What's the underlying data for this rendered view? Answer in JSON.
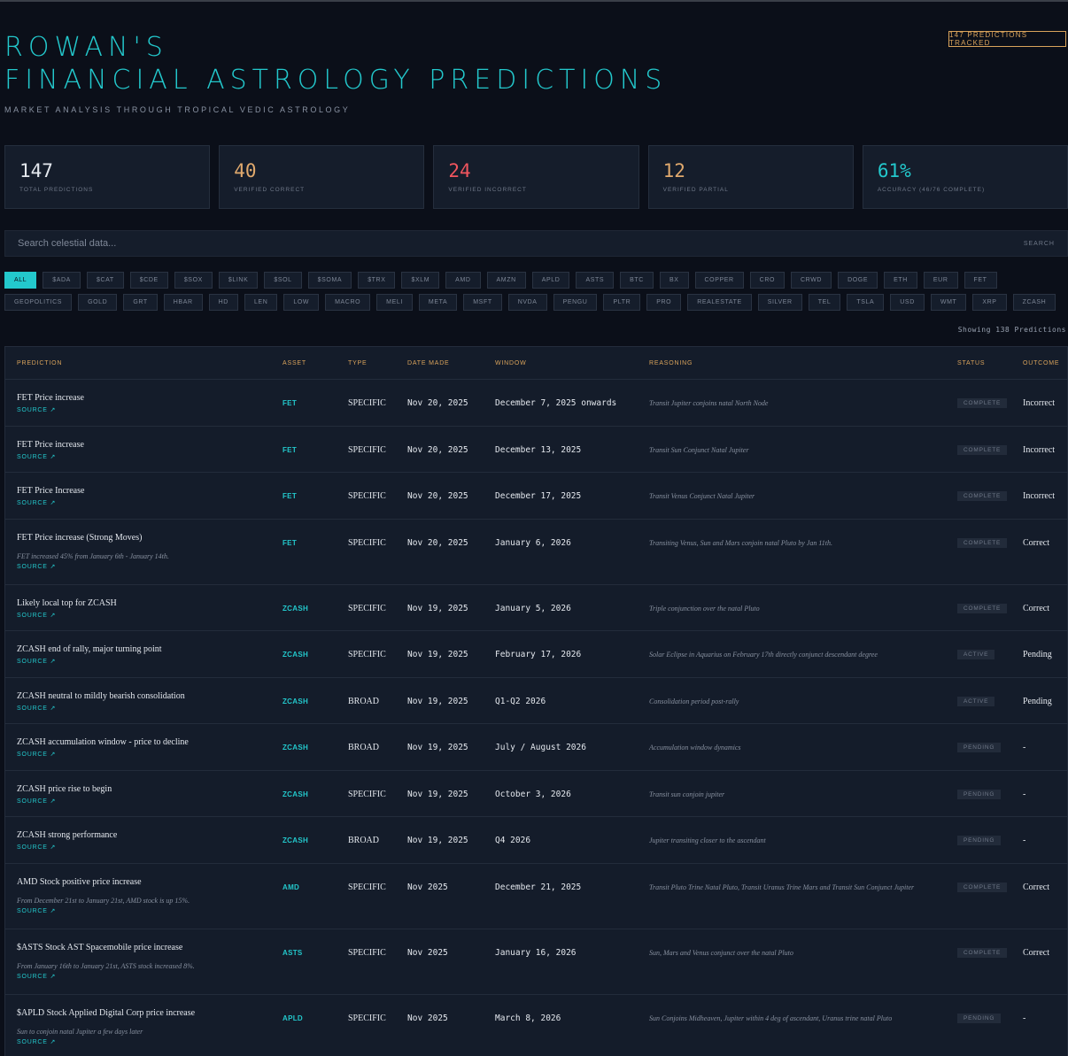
{
  "header": {
    "title_line1": "ROWAN'S",
    "title_line2": "FINANCIAL ASTROLOGY PREDICTIONS",
    "subtitle": "MARKET ANALYSIS THROUGH TROPICAL VEDIC ASTROLOGY",
    "tracked_badge": "147 PREDICTIONS TRACKED"
  },
  "stats": [
    {
      "value": "147",
      "label": "TOTAL PREDICTIONS",
      "color": "#e4e8ee"
    },
    {
      "value": "40",
      "label": "VERIFIED CORRECT",
      "color": "#e0a96d"
    },
    {
      "value": "24",
      "label": "VERIFIED INCORRECT",
      "color": "#f0555e"
    },
    {
      "value": "12",
      "label": "VERIFIED PARTIAL",
      "color": "#e0a96d"
    },
    {
      "value": "61%",
      "label": "ACCURACY (46/76 COMPLETE)",
      "color": "#23c8cc"
    }
  ],
  "search": {
    "placeholder": "Search celestial data...",
    "button": "SEARCH"
  },
  "filters": {
    "active": "ALL",
    "items": [
      "ALL",
      "$ADA",
      "$CAT",
      "$CDE",
      "$SOX",
      "$LINK",
      "$SOL",
      "$SOMA",
      "$TRX",
      "$XLM",
      "AMD",
      "AMZN",
      "APLD",
      "ASTS",
      "BTC",
      "BX",
      "COPPER",
      "CRO",
      "CRWD",
      "DOGE",
      "ETH",
      "EUR",
      "FET",
      "GEOPOLITICS",
      "GOLD",
      "GRT",
      "HBAR",
      "HD",
      "LEN",
      "LOW",
      "MACRO",
      "MELI",
      "META",
      "MSFT",
      "NVDA",
      "PENGU",
      "PLTR",
      "PRO",
      "REALESTATE",
      "SILVER",
      "TEL",
      "TSLA",
      "USD",
      "WMT",
      "XRP",
      "ZCASH"
    ]
  },
  "showing": "Showing 138 Predictions",
  "table": {
    "headers": {
      "prediction": "PREDICTION",
      "asset": "ASSET",
      "type": "TYPE",
      "date_made": "DATE MADE",
      "window": "WINDOW",
      "reasoning": "REASONING",
      "status": "STATUS",
      "outcome": "OUTCOME"
    },
    "source_label": "SOURCE ↗",
    "rows": [
      {
        "prediction": "FET Price increase",
        "note": "",
        "asset": "FET",
        "type": "SPECIFIC",
        "date": "Nov 20, 2025",
        "window": "December 7, 2025 onwards",
        "reasoning": "Transit Jupiter conjoins natal North Node",
        "status": "COMPLETE",
        "outcome": "Incorrect"
      },
      {
        "prediction": "FET Price increase",
        "note": "",
        "asset": "FET",
        "type": "SPECIFIC",
        "date": "Nov 20, 2025",
        "window": "December 13, 2025",
        "reasoning": "Transit Sun Conjunct Natal Jupiter",
        "status": "COMPLETE",
        "outcome": "Incorrect"
      },
      {
        "prediction": "FET Price Increase",
        "note": "",
        "asset": "FET",
        "type": "SPECIFIC",
        "date": "Nov 20, 2025",
        "window": "December 17, 2025",
        "reasoning": "Transit Venus Conjunct Natal Jupiter",
        "status": "COMPLETE",
        "outcome": "Incorrect"
      },
      {
        "prediction": "FET Price increase (Strong Moves)",
        "note": "FET increased 45% from January 6th - January 14th.",
        "asset": "FET",
        "type": "SPECIFIC",
        "date": "Nov 20, 2025",
        "window": "January 6, 2026",
        "reasoning": "Transiting Venus, Sun and Mars conjoin natal Pluto by Jan 11th.",
        "status": "COMPLETE",
        "outcome": "Correct"
      },
      {
        "prediction": "Likely local top for ZCASH",
        "note": "",
        "asset": "ZCASH",
        "type": "SPECIFIC",
        "date": "Nov 19, 2025",
        "window": "January 5, 2026",
        "reasoning": "Triple conjunction over the natal Pluto",
        "status": "COMPLETE",
        "outcome": "Correct"
      },
      {
        "prediction": "ZCASH end of rally, major turning point",
        "note": "",
        "asset": "ZCASH",
        "type": "SPECIFIC",
        "date": "Nov 19, 2025",
        "window": "February 17, 2026",
        "reasoning": "Solar Eclipse in Aquarius on February 17th directly conjunct descendant degree",
        "status": "ACTIVE",
        "outcome": "Pending"
      },
      {
        "prediction": "ZCASH neutral to mildly bearish consolidation",
        "note": "",
        "asset": "ZCASH",
        "type": "BROAD",
        "date": "Nov 19, 2025",
        "window": "Q1-Q2 2026",
        "reasoning": "Consolidation period post-rally",
        "status": "ACTIVE",
        "outcome": "Pending"
      },
      {
        "prediction": "ZCASH accumulation window - price to decline",
        "note": "",
        "asset": "ZCASH",
        "type": "BROAD",
        "date": "Nov 19, 2025",
        "window": "July / August 2026",
        "reasoning": "Accumulation window dynamics",
        "status": "PENDING",
        "outcome": "-"
      },
      {
        "prediction": "ZCASH price rise to begin",
        "note": "",
        "asset": "ZCASH",
        "type": "SPECIFIC",
        "date": "Nov 19, 2025",
        "window": "October 3, 2026",
        "reasoning": "Transit sun conjoin jupiter",
        "status": "PENDING",
        "outcome": "-"
      },
      {
        "prediction": "ZCASH strong performance",
        "note": "",
        "asset": "ZCASH",
        "type": "BROAD",
        "date": "Nov 19, 2025",
        "window": "Q4 2026",
        "reasoning": "Jupiter transiting closer to the ascendant",
        "status": "PENDING",
        "outcome": "-"
      },
      {
        "prediction": "AMD Stock positive price increase",
        "note": "From December 21st to January 21st, AMD stock is up 15%.",
        "asset": "AMD",
        "type": "SPECIFIC",
        "date": "Nov 2025",
        "window": "December 21, 2025",
        "reasoning": "Transit Pluto Trine Natal Pluto, Transit Uranus Trine Mars and Transit Sun Conjunct Jupiter",
        "status": "COMPLETE",
        "outcome": "Correct"
      },
      {
        "prediction": "$ASTS Stock AST Spacemobile price increase",
        "note": "From January 16th to January 21st, ASTS stock increased 8%.",
        "asset": "ASTS",
        "type": "SPECIFIC",
        "date": "Nov 2025",
        "window": "January 16, 2026",
        "reasoning": "Sun, Mars and Venus conjunct over the natal Pluto",
        "status": "COMPLETE",
        "outcome": "Correct"
      },
      {
        "prediction": "$APLD Stock Applied Digital Corp price increase",
        "note": "Sun to conjoin natal Jupiter a few days later",
        "asset": "APLD",
        "type": "SPECIFIC",
        "date": "Nov 2025",
        "window": "March 8, 2026",
        "reasoning": "Sun Conjoins Midheaven, Jupiter within 4 deg of ascendant, Uranus trine natal Pluto",
        "status": "PENDING",
        "outcome": "-"
      }
    ]
  }
}
